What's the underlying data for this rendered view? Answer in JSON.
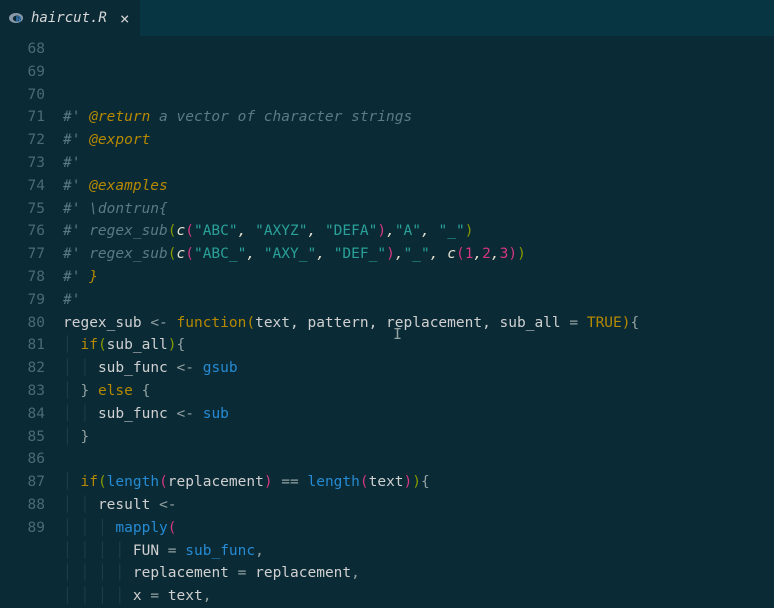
{
  "tab": {
    "filename": "haircut.R",
    "close_glyph": "×"
  },
  "gutter": {
    "start": 68,
    "end": 89
  },
  "code": {
    "l68": {
      "prefix": "#'",
      "tag": "@return",
      "rest": " a vector of character strings"
    },
    "l69": {
      "prefix": "#'",
      "tag": "@export"
    },
    "l70": {
      "prefix": "#'"
    },
    "l71": {
      "prefix": "#'",
      "tag": "@examples"
    },
    "l72": {
      "prefix": "#'",
      "text": " \\dontrun{"
    },
    "l73": {
      "prefix": "#' regex_sub",
      "s1": "\"ABC\"",
      "s2": "\"AXYZ\"",
      "s3": "\"DEFA\"",
      "s4": "\"A\"",
      "s5": "\"_\""
    },
    "l74": {
      "prefix": "#' regex_sub",
      "s1": "\"ABC_\"",
      "s2": "\"AXY_\"",
      "s3": "\"DEF_\"",
      "s4": "\"_\"",
      "n1": "1",
      "n2": "2",
      "n3": "3"
    },
    "l75": {
      "prefix": "#'",
      "brace": " }"
    },
    "l76": {
      "prefix": "#'"
    },
    "l77": {
      "name": "regex_sub",
      "kw": "function",
      "params": "text, pattern, replacement, sub_all",
      "eq": " = ",
      "tru": "TRUE"
    },
    "l78": {
      "kw": "if",
      "arg": "sub_all"
    },
    "l79": {
      "lhs": "sub_func",
      "rhs": "gsub"
    },
    "l80": {
      "kw": "else"
    },
    "l81": {
      "lhs": "sub_func",
      "rhs": "sub"
    },
    "l84": {
      "kw": "if",
      "fn1": "length",
      "arg1": "replacement",
      "op": " == ",
      "fn2": "length",
      "arg2": "text"
    },
    "l85": {
      "lhs": "result"
    },
    "l86": {
      "fn": "mapply"
    },
    "l87": {
      "key": "FUN",
      "val": "sub_func"
    },
    "l88": {
      "key": "replacement",
      "val": "replacement"
    },
    "l89": {
      "key": "x",
      "val": "text"
    }
  }
}
